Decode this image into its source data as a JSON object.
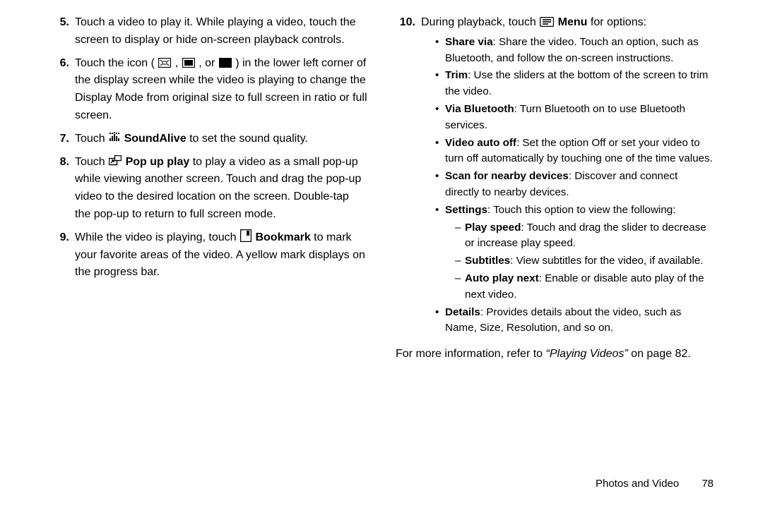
{
  "left": {
    "items": [
      {
        "num": "5.",
        "text": "Touch a video to play it. While playing a video, touch the screen to display or hide on-screen playback controls."
      },
      {
        "num": "6.",
        "prefix": "Touch the icon (",
        "mid1": " , ",
        "mid2": " , or  ",
        "suffix": " ) in the lower left corner of the display screen while the video is playing to change the Display Mode from original size to full screen in ratio or full screen."
      },
      {
        "num": "7.",
        "pre": "Touch ",
        "bold": "SoundAlive",
        "post": " to set the sound quality."
      },
      {
        "num": "8.",
        "pre": "Touch ",
        "bold": "Pop up play",
        "post": " to play a video as a small pop-up while viewing another screen. Touch and drag the pop-up video to the desired location on the screen. Double-tap the pop-up to return to full screen mode."
      },
      {
        "num": "9.",
        "pre": "While the video is playing, touch ",
        "bold": "Bookmark",
        "post": " to mark your favorite areas of the video. A yellow mark displays on the progress bar."
      }
    ]
  },
  "right": {
    "lead": {
      "num": "10.",
      "pre": "During playback, touch ",
      "bold": "Menu",
      "post": " for options:"
    },
    "bullets": [
      {
        "label": "Share via",
        "text": ": Share the video. Touch an option, such as Bluetooth, and follow the on-screen instructions."
      },
      {
        "label": "Trim",
        "text": ": Use the sliders at the bottom of the screen to trim the video."
      },
      {
        "label": "Via Bluetooth",
        "text": ": Turn Bluetooth on to use Bluetooth services."
      },
      {
        "label": "Video auto off",
        "text": ": Set the option Off or set your video to turn off automatically by touching one of the time values."
      },
      {
        "label": "Scan for nearby devices",
        "text": ": Discover and connect directly to nearby devices."
      },
      {
        "label": "Settings",
        "text": ": Touch this option to view the following:",
        "dashes": [
          {
            "label": "Play speed",
            "text": ": Touch and drag the slider to decrease or increase play speed."
          },
          {
            "label": "Subtitles",
            "text": ": View subtitles for the video, if available."
          },
          {
            "label": "Auto play next",
            "text": ": Enable or disable auto play of the next video."
          }
        ]
      },
      {
        "label": "Details",
        "text": ": Provides details about the video, such as Name, Size, Resolution, and so on."
      }
    ],
    "more": {
      "pre": "For more information, refer to ",
      "ref": "“Playing Videos”",
      "post": " on page 82."
    }
  },
  "footer": {
    "section": "Photos and Video",
    "page": "78"
  }
}
